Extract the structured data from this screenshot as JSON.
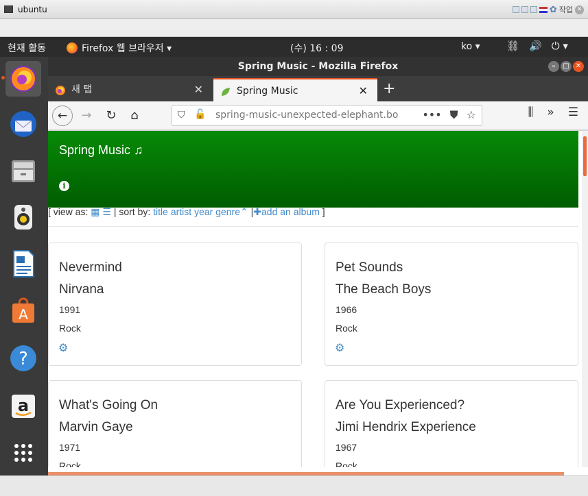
{
  "vm": {
    "title": "ubuntu",
    "tray_label": "작업"
  },
  "top_panel": {
    "activities": "현재 활동",
    "app_menu": "Firefox 웹 브라우저 ▾",
    "clock": "(수) 16 : 09",
    "language": "ko ▾"
  },
  "dock": {
    "items": [
      "firefox",
      "thunderbird",
      "files",
      "rhythmbox",
      "libreoffice-writer",
      "software-center",
      "help",
      "amazon",
      "show-apps"
    ]
  },
  "firefox": {
    "window_title": "Spring Music - Mozilla Firefox",
    "tabs": [
      {
        "label": "새 탭"
      },
      {
        "label": "Spring Music"
      }
    ],
    "url": "spring-music-unexpected-elephant.bo"
  },
  "page": {
    "brand": "Spring Music ♫",
    "toolbar": {
      "view_as_prefix": "[ view as:",
      "sort_by": "| sort by:",
      "sort_title": "title",
      "sort_artist": "artist",
      "sort_year": "year",
      "sort_genre": "genre",
      "separator": "|",
      "add_album": "add an album",
      "suffix": "]"
    },
    "albums": [
      {
        "title": "Nevermind",
        "artist": "Nirvana",
        "year": "1991",
        "genre": "Rock"
      },
      {
        "title": "Pet Sounds",
        "artist": "The Beach Boys",
        "year": "1966",
        "genre": "Rock"
      },
      {
        "title": "What's Going On",
        "artist": "Marvin Gaye",
        "year": "1971",
        "genre": "Rock"
      },
      {
        "title": "Are You Experienced?",
        "artist": "Jimi Hendrix Experience",
        "year": "1967",
        "genre": "Rock"
      }
    ]
  },
  "colors": {
    "accent": "#e95420",
    "hero": "#078a07",
    "link": "#428bca"
  }
}
